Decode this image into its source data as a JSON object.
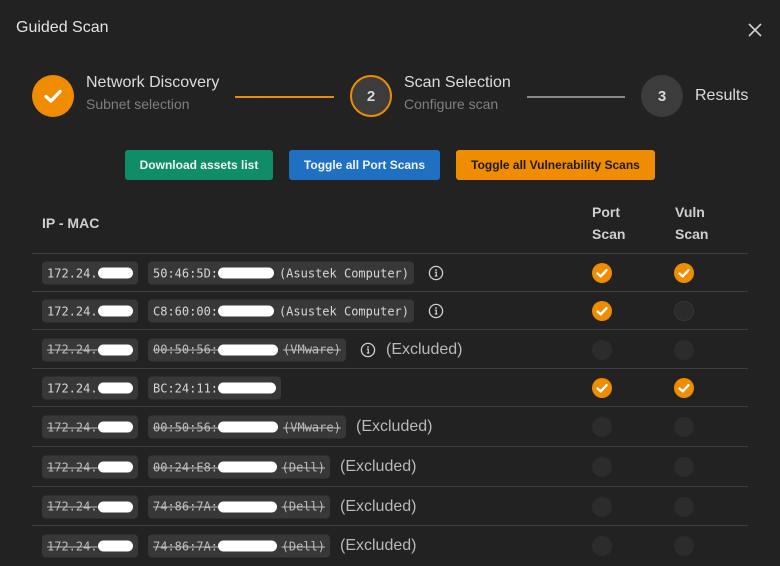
{
  "dialog": {
    "title": "Guided Scan",
    "close_icon": "close-icon"
  },
  "stepper": {
    "steps": [
      {
        "number": "1",
        "title": "Network Discovery",
        "subtitle": "Subnet selection",
        "state": "completed"
      },
      {
        "number": "2",
        "title": "Scan Selection",
        "subtitle": "Configure scan",
        "state": "active"
      },
      {
        "number": "3",
        "title": "Results",
        "subtitle": "",
        "state": "pending"
      }
    ]
  },
  "actions": {
    "download_label": "Download assets list",
    "toggle_port_label": "Toggle all Port Scans",
    "toggle_vuln_label": "Toggle all Vulnerability Scans"
  },
  "colors": {
    "accent": "#ef8c00",
    "download": "#0f8c68",
    "toggle_port": "#1f70c1",
    "background": "#222222"
  },
  "table": {
    "headers": {
      "ip_mac": "IP - MAC",
      "port_line1": "Port",
      "port_line2": "Scan",
      "vuln_line1": "Vuln",
      "vuln_line2": "Scan"
    },
    "excluded_label": "(Excluded)",
    "rows": [
      {
        "ip_prefix": "172.24.",
        "mac_prefix": "50:46:5D:",
        "vendor": "(Asustek Computer)",
        "info": true,
        "excluded": false,
        "port_scan": true,
        "vuln_scan": true
      },
      {
        "ip_prefix": "172.24.",
        "mac_prefix": "C8:60:00:",
        "vendor": "(Asustek Computer)",
        "info": true,
        "excluded": false,
        "port_scan": true,
        "vuln_scan": false
      },
      {
        "ip_prefix": "172.24.",
        "mac_prefix": "00:50:56:",
        "vendor": "(VMware)",
        "info": true,
        "excluded": true,
        "port_scan": false,
        "vuln_scan": false
      },
      {
        "ip_prefix": "172.24.",
        "mac_prefix": "BC:24:11:",
        "vendor": "",
        "info": false,
        "excluded": false,
        "port_scan": true,
        "vuln_scan": true
      },
      {
        "ip_prefix": "172.24.",
        "mac_prefix": "00:50:56:",
        "vendor": "(VMware)",
        "info": false,
        "excluded": true,
        "port_scan": false,
        "vuln_scan": false
      },
      {
        "ip_prefix": "172.24.",
        "mac_prefix": "00:24:E8:",
        "vendor": "(Dell)",
        "info": false,
        "excluded": true,
        "port_scan": false,
        "vuln_scan": false
      },
      {
        "ip_prefix": "172.24.",
        "mac_prefix": "74:86:7A:",
        "vendor": "(Dell)",
        "info": false,
        "excluded": true,
        "port_scan": false,
        "vuln_scan": false
      },
      {
        "ip_prefix": "172.24.",
        "mac_prefix": "74:86:7A:",
        "vendor": "(Dell)",
        "info": false,
        "excluded": true,
        "port_scan": false,
        "vuln_scan": false
      }
    ]
  }
}
